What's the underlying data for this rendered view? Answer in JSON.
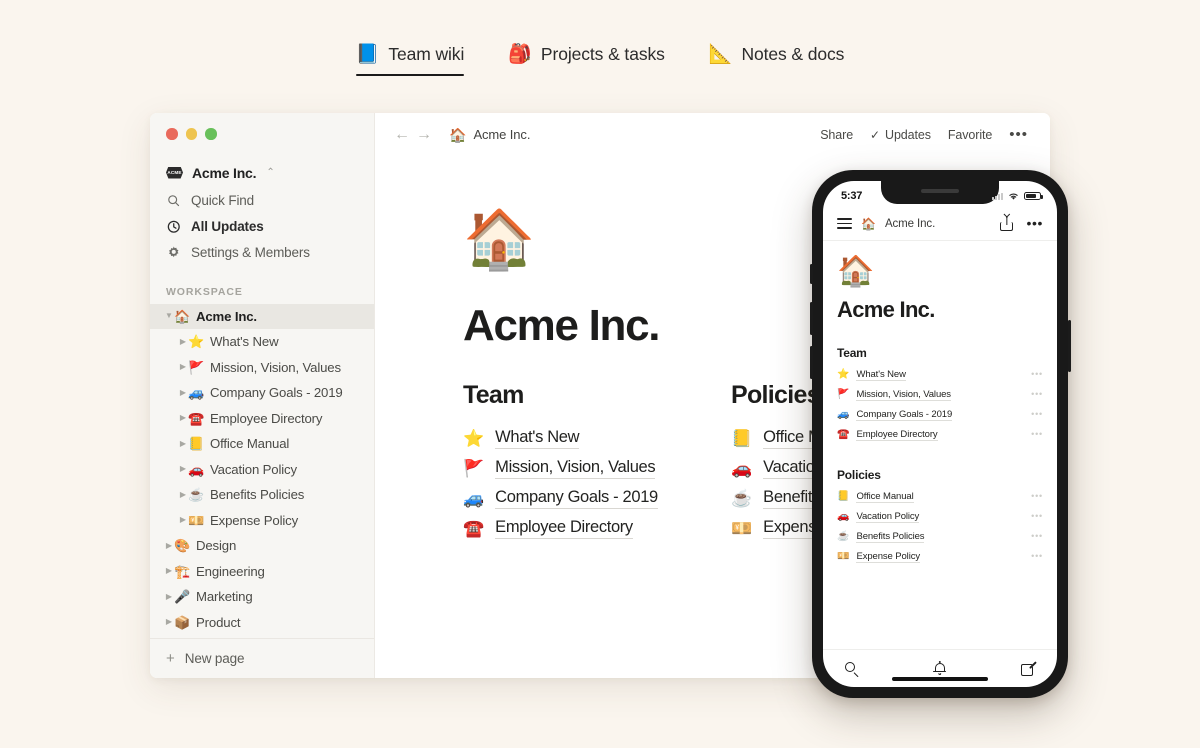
{
  "tabs": [
    {
      "emoji": "📘",
      "icon_name": "blue-book-icon",
      "label": "Team wiki",
      "active": true
    },
    {
      "emoji": "🎒",
      "icon_name": "backpack-icon",
      "label": "Projects & tasks",
      "active": false
    },
    {
      "emoji": "📐",
      "icon_name": "triangular-ruler-icon",
      "label": "Notes & docs",
      "active": false
    }
  ],
  "desktop": {
    "sidebar": {
      "workspace_badge_text": "ACME",
      "workspace_name": "Acme Inc.",
      "workspace_chevron": "⌃⌄",
      "nav": [
        {
          "icon_name": "search-icon",
          "label": "Quick Find",
          "strong": false
        },
        {
          "icon_name": "clock-icon",
          "label": "All Updates",
          "strong": true
        },
        {
          "icon_name": "gear-icon",
          "label": "Settings & Members",
          "strong": false
        }
      ],
      "section_label": "WORKSPACE",
      "tree": [
        {
          "level": 0,
          "arrow": "▼",
          "emoji": "🏠",
          "label": "Acme Inc.",
          "selected": true
        },
        {
          "level": 1,
          "arrow": "▶",
          "emoji": "⭐",
          "label": "What's New",
          "selected": false
        },
        {
          "level": 1,
          "arrow": "▶",
          "emoji": "🚩",
          "label": "Mission, Vision, Values",
          "selected": false
        },
        {
          "level": 1,
          "arrow": "▶",
          "emoji": "🚙",
          "label": "Company Goals - 2019",
          "selected": false
        },
        {
          "level": 1,
          "arrow": "▶",
          "emoji": "☎️",
          "label": "Employee Directory",
          "selected": false
        },
        {
          "level": 1,
          "arrow": "▶",
          "emoji": "📒",
          "label": "Office Manual",
          "selected": false
        },
        {
          "level": 1,
          "arrow": "▶",
          "emoji": "🚗",
          "label": "Vacation Policy",
          "selected": false
        },
        {
          "level": 1,
          "arrow": "▶",
          "emoji": "☕",
          "label": "Benefits Policies",
          "selected": false
        },
        {
          "level": 1,
          "arrow": "▶",
          "emoji": "💴",
          "label": "Expense Policy",
          "selected": false
        },
        {
          "level": 0,
          "arrow": "▶",
          "emoji": "🎨",
          "label": "Design",
          "selected": false
        },
        {
          "level": 0,
          "arrow": "▶",
          "emoji": "🏗️",
          "label": "Engineering",
          "selected": false
        },
        {
          "level": 0,
          "arrow": "▶",
          "emoji": "🎤",
          "label": "Marketing",
          "selected": false
        },
        {
          "level": 0,
          "arrow": "▶",
          "emoji": "📦",
          "label": "Product",
          "selected": false
        }
      ],
      "new_page_label": "New page",
      "new_page_plus": "+"
    },
    "topbar": {
      "back_arrow": "←",
      "forward_arrow": "→",
      "breadcrumb_emoji": "🏠",
      "breadcrumb_label": "Acme Inc.",
      "share_label": "Share",
      "updates_check": "✓",
      "updates_label": "Updates",
      "favorite_label": "Favorite",
      "more_label": "•••"
    },
    "page": {
      "icon": "🏠",
      "title": "Acme Inc.",
      "columns": [
        {
          "heading": "Team",
          "links": [
            {
              "emoji": "⭐",
              "label": "What's New"
            },
            {
              "emoji": "🚩",
              "label": "Mission, Vision, Values"
            },
            {
              "emoji": "🚙",
              "label": "Company Goals - 2019"
            },
            {
              "emoji": "☎️",
              "label": "Employee Directory"
            }
          ]
        },
        {
          "heading": "Policies",
          "links": [
            {
              "emoji": "📒",
              "label": "Office Manual"
            },
            {
              "emoji": "🚗",
              "label": "Vacation Policy"
            },
            {
              "emoji": "☕",
              "label": "Benefits Policies"
            },
            {
              "emoji": "💴",
              "label": "Expense Policy"
            }
          ]
        }
      ]
    }
  },
  "phone": {
    "status": {
      "time": "5:37"
    },
    "topbar": {
      "menu_icon": "hamburger-menu-icon",
      "breadcrumb_emoji": "🏠",
      "breadcrumb_label": "Acme Inc.",
      "share_icon": "share-icon",
      "more_label": "•••"
    },
    "page": {
      "icon": "🏠",
      "title": "Acme Inc.",
      "sections": [
        {
          "heading": "Team",
          "links": [
            {
              "emoji": "⭐",
              "label": "What's New",
              "more": "•••"
            },
            {
              "emoji": "🚩",
              "label": "Mission, Vision, Values",
              "more": "•••"
            },
            {
              "emoji": "🚙",
              "label": "Company Goals - 2019",
              "more": "•••"
            },
            {
              "emoji": "☎️",
              "label": "Employee Directory",
              "more": "•••"
            }
          ]
        },
        {
          "heading": "Policies",
          "links": [
            {
              "emoji": "📒",
              "label": "Office Manual",
              "more": "•••"
            },
            {
              "emoji": "🚗",
              "label": "Vacation Policy",
              "more": "•••"
            },
            {
              "emoji": "☕",
              "label": "Benefits Policies",
              "more": "•••"
            },
            {
              "emoji": "💴",
              "label": "Expense Policy",
              "more": "•••"
            }
          ]
        }
      ]
    },
    "tabbar": [
      {
        "icon_name": "search-icon"
      },
      {
        "icon_name": "bell-icon"
      },
      {
        "icon_name": "compose-icon"
      }
    ]
  },
  "colors": {
    "page_background": "#faf5ee",
    "sidebar_background": "#f7f6f3",
    "window_background": "#ffffff",
    "selected_row": "#e9e7e2",
    "text_primary": "#1d1d1c",
    "text_secondary": "#5d5d58",
    "phone_frame": "#191919",
    "traffic_red": "#e96a5c",
    "traffic_yellow": "#eec44f",
    "traffic_green": "#68c05a"
  }
}
